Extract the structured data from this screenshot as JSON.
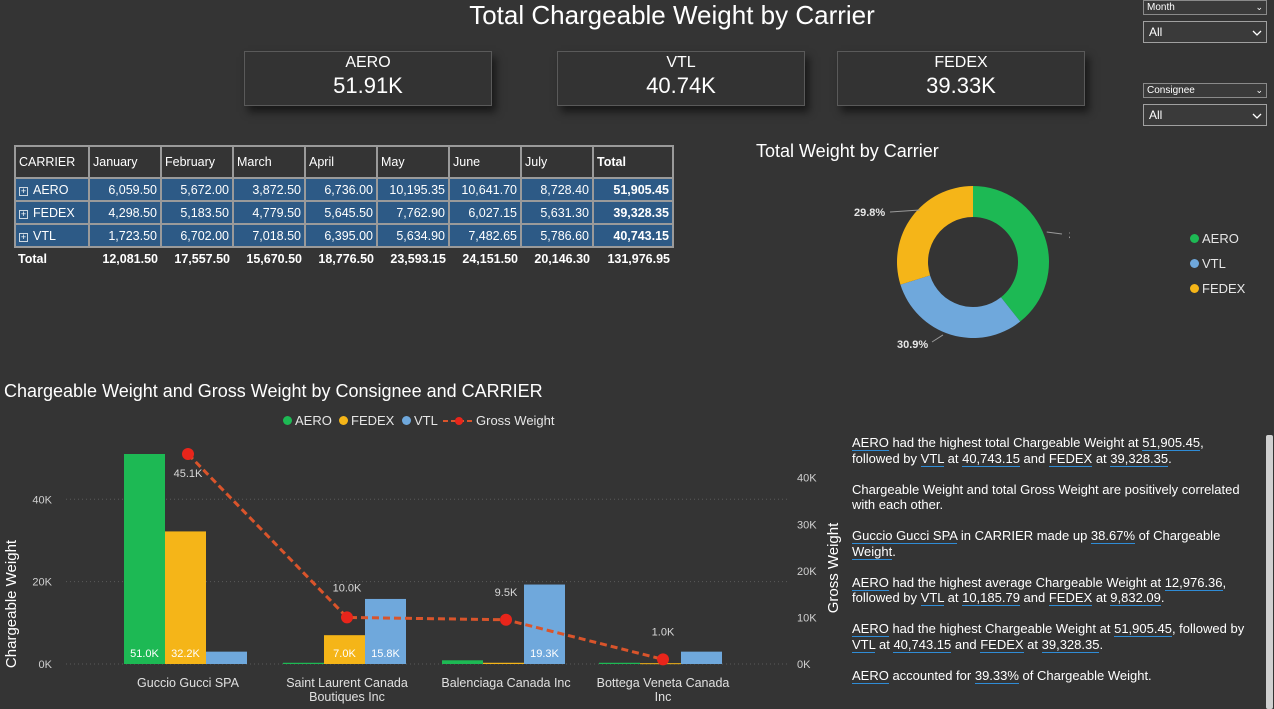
{
  "page_title": "Total Chargeable Weight by Carrier",
  "slicers": {
    "month": {
      "label": "Month",
      "value": "All"
    },
    "consignee": {
      "label": "Consignee",
      "value": "All"
    }
  },
  "kpis": [
    {
      "label": "AERO",
      "value": "51.91K"
    },
    {
      "label": "VTL",
      "value": "40.74K"
    },
    {
      "label": "FEDEX",
      "value": "39.33K"
    }
  ],
  "matrix": {
    "headers": [
      "CARRIER",
      "January",
      "February",
      "March",
      "April",
      "May",
      "June",
      "July",
      "Total"
    ],
    "rows": [
      {
        "carrier": "AERO",
        "values": [
          "6,059.50",
          "5,672.00",
          "3,872.50",
          "6,736.00",
          "10,195.35",
          "10,641.70",
          "8,728.40"
        ],
        "total": "51,905.45"
      },
      {
        "carrier": "FEDEX",
        "values": [
          "4,298.50",
          "5,183.50",
          "4,779.50",
          "5,645.50",
          "7,762.90",
          "6,027.15",
          "5,631.30"
        ],
        "total": "39,328.35"
      },
      {
        "carrier": "VTL",
        "values": [
          "1,723.50",
          "6,702.00",
          "7,018.50",
          "6,395.00",
          "5,634.90",
          "7,482.65",
          "5,786.60"
        ],
        "total": "40,743.15"
      }
    ],
    "total_row": {
      "label": "Total",
      "values": [
        "12,081.50",
        "17,557.50",
        "15,670.50",
        "18,776.50",
        "23,593.15",
        "24,151.50",
        "20,146.30"
      ],
      "total": "131,976.95"
    }
  },
  "colors": {
    "aero": "#1db954",
    "vtl": "#6fa8dc",
    "fedex": "#f5b518",
    "gross": "#e8251b",
    "gross_line": "#d9542b",
    "table_row": "#2d5a86"
  },
  "chart_data": [
    {
      "type": "pie",
      "title": "Total Weight by Carrier",
      "categories": [
        "AERO",
        "VTL",
        "FEDEX"
      ],
      "values": [
        51905.45,
        40743.15,
        39328.35
      ],
      "labels": [
        "39.3%",
        "30.9%",
        "29.8%"
      ],
      "legend": [
        "AERO",
        "VTL",
        "FEDEX"
      ],
      "legend_position": "right"
    },
    {
      "type": "bar",
      "title": "Chargeable Weight and Gross Weight by Consignee and CARRIER",
      "categories": [
        "Guccio Gucci SPA",
        "Saint Laurent Canada Boutiques Inc",
        "Balenciaga Canada Inc",
        "Bottega Veneta Canada Inc"
      ],
      "series": [
        {
          "name": "AERO",
          "values": [
            51000,
            300,
            900,
            300
          ],
          "labels": [
            "51.0K",
            "",
            "",
            ""
          ]
        },
        {
          "name": "FEDEX",
          "values": [
            32200,
            7000,
            300,
            200
          ],
          "labels": [
            "32.2K",
            "7.0K",
            "",
            ""
          ]
        },
        {
          "name": "VTL",
          "values": [
            3000,
            15800,
            19300,
            3000
          ],
          "labels": [
            "",
            "15.8K",
            "19.3K",
            ""
          ]
        }
      ],
      "line_series": {
        "name": "Gross Weight",
        "values": [
          45100,
          10000,
          9500,
          1000
        ],
        "labels": [
          "45.1K",
          "10.0K",
          "9.5K",
          "1.0K"
        ]
      },
      "ylabel": "Chargeable Weight",
      "y2label": "Gross Weight",
      "yticks": [
        "0K",
        "20K",
        "40K"
      ],
      "y2ticks": [
        "0K",
        "10K",
        "20K",
        "30K",
        "40K"
      ],
      "ylim": [
        0,
        51000
      ],
      "y2lim": [
        0,
        45100
      ],
      "legend": [
        "AERO",
        "FEDEX",
        "VTL",
        "Gross Weight"
      ],
      "legend_position": "top"
    }
  ],
  "narrative": {
    "p1": {
      "a": "AERO",
      "b": " had the highest total Chargeable Weight at ",
      "c": "51,905.45",
      "d": ",",
      "e": "followed by ",
      "f": "VTL",
      "g": " at ",
      "h": "40,743.15",
      "i": " and ",
      "j": "FEDEX",
      "k": " at ",
      "l": "39,328.35",
      "m": "."
    },
    "p2": "Chargeable Weight and total Gross Weight are positively correlated with each other.",
    "p3": {
      "a": "Guccio Gucci SPA",
      "b": " in CARRIER  made up ",
      "c": "38.67%",
      "d": " of Chargeable ",
      "e": "Weight",
      "f": "."
    },
    "p4": {
      "a": "AERO",
      "b": " had the highest average Chargeable Weight at ",
      "c": "12,976.36",
      "d": ",",
      "e": "followed by ",
      "f": "VTL",
      "g": " at ",
      "h": "10,185.79",
      "i": " and ",
      "j": "FEDEX",
      "k": " at ",
      "l": "9,832.09",
      "m": "."
    },
    "p5": {
      "a": "AERO",
      "b": " had the highest Chargeable Weight at ",
      "c": "51,905.45",
      "d": ", followed by ",
      "e": "VTL",
      "f": " at ",
      "g": "40,743.15",
      "h": " and ",
      "i": "FEDEX",
      "j": " at ",
      "k": "39,328.35",
      "l": "."
    },
    "p6": {
      "a": "AERO",
      "b": " accounted for ",
      "c": "39.33%",
      "d": " of Chargeable Weight."
    }
  }
}
